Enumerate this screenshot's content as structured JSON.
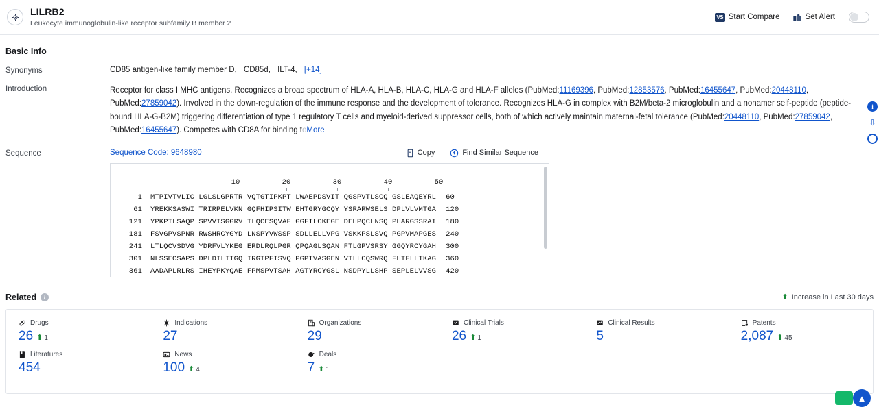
{
  "header": {
    "logo_icon": "target-crosshair-icon",
    "gene_symbol": "LILRB2",
    "gene_full_name": "Leukocyte immunoglobulin-like receptor subfamily B member 2",
    "start_compare_label": "Start Compare",
    "start_compare_icon": "vs-icon",
    "set_alert_label": "Set Alert",
    "set_alert_icon": "alert-bell-icon",
    "alert_toggle_state": "off"
  },
  "basic_info": {
    "title": "Basic Info",
    "synonyms_label": "Synonyms",
    "synonyms": [
      "CD85 antigen-like family member D,",
      "CD85d,",
      "ILT-4,"
    ],
    "synonyms_more": "[+14]",
    "introduction_label": "Introduction",
    "introduction": {
      "line1_a": "Receptor for class I MHC antigens. Recognizes a broad spectrum of HLA-A, HLA-B, HLA-C, HLA-G and HLA-F alleles (PubMed:",
      "pm1": "11169396",
      "line1_b": ", PubMed:",
      "pm2": "12853576",
      "line1_c": ", PubMed:",
      "pm3": "16455647",
      "line1_d": ", PubMed:",
      "pm4": "20448110",
      "line1_e": ", PubMed:",
      "pm5": "27859042",
      "line1_f": "). Involved in the down-regulation of the immune response and the development of tolerance. Recognizes HLA-G in complex with B2M/beta-2 microglobulin and a nonamer self-peptide (peptide-bound HLA-G-B2M) triggering differentiation of type 1 regulatory T cells and myeloid-derived suppressor cells, both of which actively maintain maternal-fetal tolerance (PubMed:",
      "pm6": "20448110",
      "line3_b": ", PubMed:",
      "pm7": "27859042",
      "line3_c": ", PubMed:",
      "pm8": "16455647",
      "line3_d": "). Competes with CD8A for binding t",
      "tail_faded": "o",
      "more_label": "More"
    }
  },
  "sequence": {
    "label": "Sequence",
    "code_label": "Sequence Code: 9648980",
    "copy_label": "Copy",
    "copy_icon": "copy-icon",
    "find_similar_label": "Find Similar Sequence",
    "find_similar_icon": "find-similar-icon",
    "ruler_ticks": [
      "10",
      "20",
      "30",
      "40",
      "50"
    ],
    "rows": [
      {
        "start": "1",
        "chunks": "MTPIVTVLIC LGLSLGPRTR VQTGTIPKPT LWAEPDSVIT QGSPVTLSCQ GSLEAQEYRL",
        "end": "60"
      },
      {
        "start": "61",
        "chunks": "YREKKSASWI TRIRPELVKN GQFHIPSITW EHTGRYGCQY YSRARWSELS DPLVLVMTGA",
        "end": "120"
      },
      {
        "start": "121",
        "chunks": "YPKPTLSAQP SPVVTSGGRV TLQCESQVAF GGFILCKEGE DEHPQCLNSQ PHARGSSRAI",
        "end": "180"
      },
      {
        "start": "181",
        "chunks": "FSVGPVSPNR RWSHRCYGYD LNSPYVWSSP SDLLELLVPG VSKKPSLSVQ PGPVMAPGES",
        "end": "240"
      },
      {
        "start": "241",
        "chunks": "LTLQCVSDVG YDRFVLYKEG ERDLRQLPGR QPQAGLSQAN FTLGPVSRSY GGQYRCYGAH",
        "end": "300"
      },
      {
        "start": "301",
        "chunks": "NLSSECSAPS DPLDILITGQ IRGTPFISVQ PGPTVASGEN VTLLCQSWRQ FHTFLLTKAG",
        "end": "360"
      },
      {
        "start": "361",
        "chunks": "AADAPLRLRS IHEYPKYQAE FPMSPVTSAH AGTYRCYGSL NSDPYLLSHP SEPLELVVSG",
        "end": "420"
      }
    ]
  },
  "related": {
    "title": "Related",
    "info_icon": "info-icon",
    "increase_note": "Increase in Last 30 days",
    "stats": [
      {
        "label": "Drugs",
        "icon": "pill-icon",
        "value": "26",
        "delta": "1"
      },
      {
        "label": "Indications",
        "icon": "virus-icon",
        "value": "27",
        "delta": ""
      },
      {
        "label": "Organizations",
        "icon": "building-icon",
        "value": "29",
        "delta": ""
      },
      {
        "label": "Clinical Trials",
        "icon": "clinical-trial-icon",
        "value": "26",
        "delta": "1"
      },
      {
        "label": "Clinical Results",
        "icon": "clinical-result-icon",
        "value": "5",
        "delta": ""
      },
      {
        "label": "Patents",
        "icon": "patent-icon",
        "value": "2,087",
        "delta": "45"
      },
      {
        "label": "Literatures",
        "icon": "book-icon",
        "value": "454",
        "delta": ""
      },
      {
        "label": "News",
        "icon": "news-icon",
        "value": "100",
        "delta": "4"
      },
      {
        "label": "Deals",
        "icon": "deal-icon",
        "value": "7",
        "delta": "1"
      }
    ]
  },
  "rail": {
    "badge": "i",
    "chevrons_icon": "double-chevron-down-icon",
    "circle_icon": "circle-outline-icon"
  },
  "colors": {
    "accent_blue": "#1155cc",
    "dark_navy": "#1f3864",
    "up_green": "#1a8a38",
    "fab_green": "#14b86a"
  }
}
